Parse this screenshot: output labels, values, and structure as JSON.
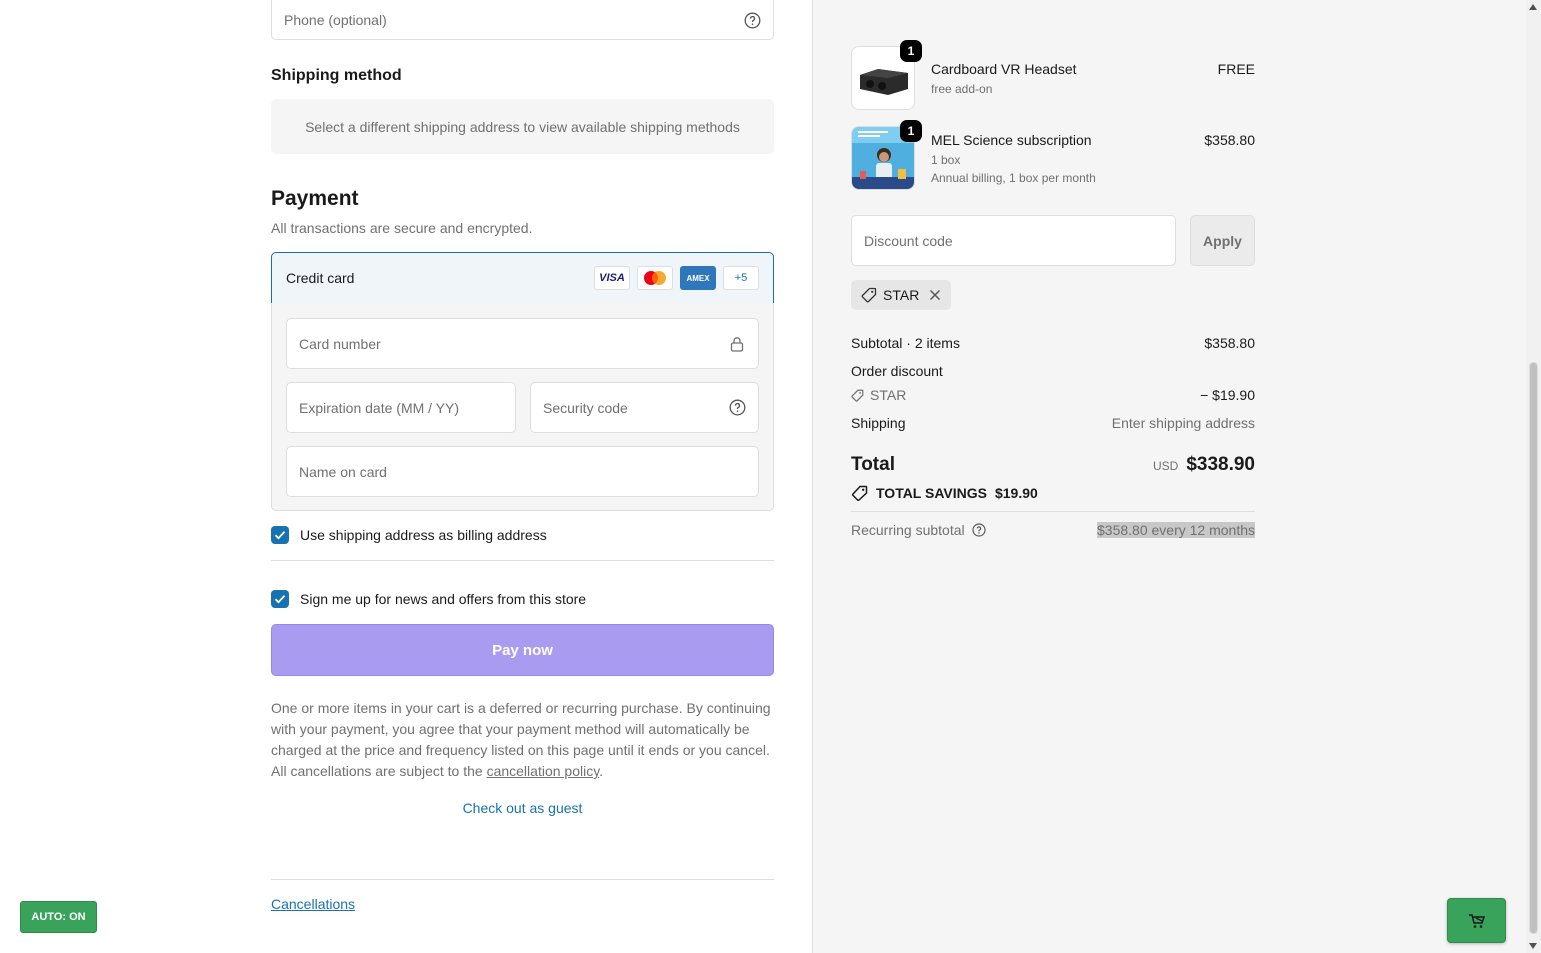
{
  "contact": {
    "phone_placeholder": "Phone (optional)"
  },
  "shipping": {
    "heading": "Shipping method",
    "notice": "Select a different shipping address to view available shipping methods"
  },
  "payment": {
    "heading": "Payment",
    "subtitle": "All transactions are secure and encrypted.",
    "method_label": "Credit card",
    "card_logos": [
      "VISA",
      "Mastercard",
      "AMEX"
    ],
    "more_cards": "+5",
    "card_number_placeholder": "Card number",
    "expiry_placeholder": "Expiration date (MM / YY)",
    "security_placeholder": "Security code",
    "name_placeholder": "Name on card",
    "billing_checkbox_label": "Use shipping address as billing address",
    "billing_checked": true,
    "news_checkbox_label": "Sign me up for news and offers from this store",
    "news_checked": true,
    "pay_button": "Pay now"
  },
  "legal": {
    "text_before": "One or more items in your cart is a deferred or recurring purchase. By continuing with your payment, you agree that your payment method will automatically be charged at the price and frequency listed on this page until it ends or you cancel. All cancellations are subject to the ",
    "link": "cancellation policy",
    "text_after": ".",
    "guest_link": "Check out as guest",
    "footer_link": "Cancellations"
  },
  "auto_badge": "AUTO: ON",
  "order": {
    "items": [
      {
        "qty": "1",
        "name": "Cardboard VR Headset",
        "sub1": "free add-on",
        "sub2": "",
        "price": "FREE"
      },
      {
        "qty": "1",
        "name": "MEL Science subscription",
        "sub1": "1 box",
        "sub2": "Annual billing, 1 box per month",
        "price": "$358.80"
      }
    ],
    "discount_placeholder": "Discount code",
    "apply_button": "Apply",
    "applied_code": "STAR",
    "subtotal_label": "Subtotal · 2 items",
    "subtotal_value": "$358.80",
    "order_discount_label": "Order discount",
    "discount_code_label": "STAR",
    "discount_value": "− $19.90",
    "shipping_label": "Shipping",
    "shipping_value": "Enter shipping address",
    "total_label": "Total",
    "total_currency": "USD",
    "total_value": "$338.90",
    "savings_label": "TOTAL SAVINGS",
    "savings_value": "$19.90",
    "recurring_label": "Recurring subtotal",
    "recurring_value": "$358.80 every 12 months"
  },
  "colors": {
    "accent": "#1773b0",
    "pay_button": "#a99cf0",
    "green_badge": "#3aa35b"
  }
}
